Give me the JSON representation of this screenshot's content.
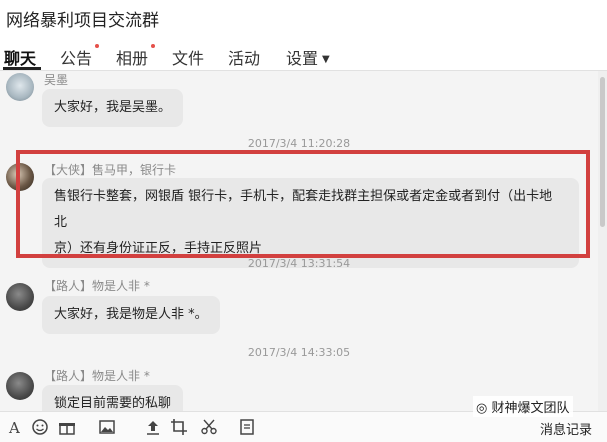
{
  "window": {
    "title": "网络暴利项目交流群"
  },
  "tabs": [
    {
      "label": "聊天"
    },
    {
      "label": "公告"
    },
    {
      "label": "相册"
    },
    {
      "label": "文件"
    },
    {
      "label": "活动"
    },
    {
      "label": "设置"
    }
  ],
  "messages": [
    {
      "sender": "吴墨",
      "text": "大家好，我是吴墨。"
    },
    {
      "time": "2017/3/4 11:20:28"
    },
    {
      "sender": "【大侠】售马甲，银行卡",
      "lines": [
        "售银行卡整套，网银盾 银行卡，手机卡，配套走找群主担保或者定金或者到付（出卡地 北",
        "京）还有身份证正反，手持正反照片"
      ]
    },
    {
      "time": "2017/3/4 13:31:54"
    },
    {
      "sender": "【路人】物是人非 *",
      "text": "大家好，我是物是人非 *。"
    },
    {
      "time": "2017/3/4 14:33:05"
    },
    {
      "sender": "【路人】物是人非 *",
      "text": "锁定目前需要的私聊"
    }
  ],
  "toolbar": {
    "icons": [
      "font-icon",
      "emoji-icon",
      "gift-icon",
      "image-icon",
      "upload-icon",
      "screenshot-icon",
      "scissors-icon",
      "document-icon"
    ],
    "history_label": "消息记录",
    "watermark": "财神爆文团队"
  },
  "colors": {
    "highlight": "#d2403f",
    "badge": "#e5504a"
  }
}
